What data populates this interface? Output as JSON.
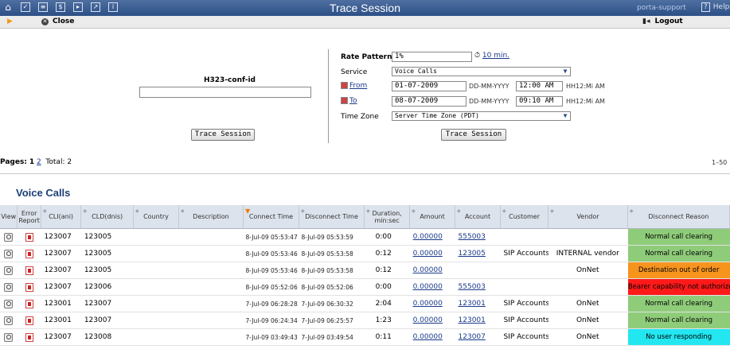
{
  "header": {
    "title": "Trace Session",
    "user": "porta-support",
    "help": "Help",
    "help_prefix": "?"
  },
  "toolbar": {
    "close_label": "Close",
    "logout_label": "Logout"
  },
  "search": {
    "h323_label": "H323-conf-id",
    "h323_value": "",
    "trace_button_left": "Trace Session",
    "rate_pattern_label": "Rate Pattern",
    "rate_pattern_value": "1%",
    "rate_interval": "10 min.",
    "service_label": "Service",
    "service_value": "Voice Calls",
    "from_label": "From",
    "from_date": "01-07-2009",
    "from_time": "12:00 AM",
    "to_label": "To",
    "to_date": "08-07-2009",
    "to_time": "09:10 AM",
    "date_format": "DD-MM-YYYY",
    "time_format": "HH12:Mi AM",
    "timezone_label": "Time Zone",
    "timezone_value": "Server Time Zone (PDT)",
    "trace_button_right": "Trace Session"
  },
  "pager": {
    "label": "Pages:",
    "current": "1",
    "other": "2",
    "total": "Total: 2",
    "range": "1–50"
  },
  "section_title": "Voice Calls",
  "table": {
    "headers": {
      "view": "View",
      "error_report": "Error Report",
      "cli": "CLI(ani)",
      "cld": "CLD(dnis)",
      "country": "Country",
      "description": "Description",
      "connect_time": "Connect Time",
      "disconnect_time": "Disconnect Time",
      "duration": "Duration, min:sec",
      "amount": "Amount",
      "account": "Account",
      "customer": "Customer",
      "vendor": "Vendor",
      "disconnect_reason": "Disconnect Reason"
    },
    "rows": [
      {
        "cli": "123007",
        "cld": "123005",
        "country": "",
        "description": "",
        "connect": "8-Jul-09 05:53:47",
        "disconnect": "8-Jul-09 05:53:59",
        "duration": "0:00",
        "amount": "0.00000",
        "account": "555003",
        "customer": "",
        "vendor": "",
        "reason": "Normal call clearing",
        "reason_color": "#8fcc7a"
      },
      {
        "cli": "123007",
        "cld": "123005",
        "country": "",
        "description": "",
        "connect": "8-Jul-09 05:53:46",
        "disconnect": "8-Jul-09 05:53:58",
        "duration": "0:12",
        "amount": "0.00000",
        "account": "123005",
        "customer": "SIP Accounts",
        "vendor": "INTERNAL vendor",
        "reason": "Normal call clearing",
        "reason_color": "#8fcc7a"
      },
      {
        "cli": "123007",
        "cld": "123005",
        "country": "",
        "description": "",
        "connect": "8-Jul-09 05:53:46",
        "disconnect": "8-Jul-09 05:53:58",
        "duration": "0:12",
        "amount": "0.00000",
        "account": "",
        "customer": "",
        "vendor": "OnNet",
        "reason": "Destination out of order",
        "reason_color": "#f7941d"
      },
      {
        "cli": "123007",
        "cld": "123006",
        "country": "",
        "description": "",
        "connect": "8-Jul-09 05:52:06",
        "disconnect": "8-Jul-09 05:52:06",
        "duration": "0:00",
        "amount": "0.00000",
        "account": "555003",
        "customer": "",
        "vendor": "",
        "reason": "Bearer capability not authorized",
        "reason_color": "#ff1a1a"
      },
      {
        "cli": "123001",
        "cld": "123007",
        "country": "",
        "description": "",
        "connect": "7-Jul-09 06:28:28",
        "disconnect": "7-Jul-09 06:30:32",
        "duration": "2:04",
        "amount": "0.00000",
        "account": "123001",
        "customer": "SIP Accounts",
        "vendor": "OnNet",
        "reason": "Normal call clearing",
        "reason_color": "#8fcc7a"
      },
      {
        "cli": "123001",
        "cld": "123007",
        "country": "",
        "description": "",
        "connect": "7-Jul-09 06:24:34",
        "disconnect": "7-Jul-09 06:25:57",
        "duration": "1:23",
        "amount": "0.00000",
        "account": "123001",
        "customer": "SIP Accounts",
        "vendor": "OnNet",
        "reason": "Normal call clearing",
        "reason_color": "#8fcc7a"
      },
      {
        "cli": "123007",
        "cld": "123008",
        "country": "",
        "description": "",
        "connect": "7-Jul-09 03:49:43",
        "disconnect": "7-Jul-09 03:49:54",
        "duration": "0:11",
        "amount": "0.00000",
        "account": "123007",
        "customer": "SIP Accounts",
        "vendor": "OnNet",
        "reason": "No user responding",
        "reason_color": "#22e6f0"
      }
    ]
  },
  "icons": [
    "home-icon",
    "dashboard-icon",
    "customers-icon",
    "billing-icon",
    "tariffs-icon",
    "reports-icon",
    "info-icon",
    "close-icon",
    "logout-icon",
    "clock-icon",
    "calendar-icon",
    "view-icon",
    "error-report-icon"
  ]
}
